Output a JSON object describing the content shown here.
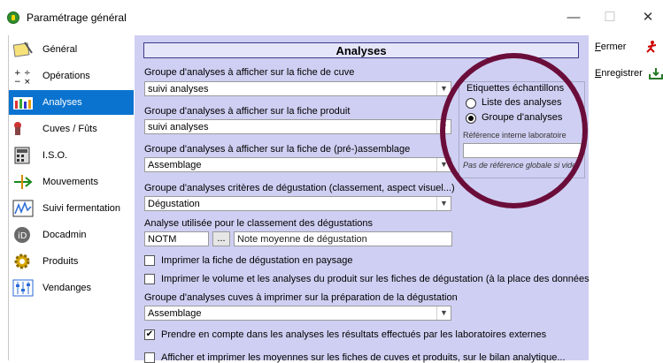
{
  "window": {
    "title": "Paramétrage général",
    "minimize_glyph": "—",
    "maximize_glyph": "☐",
    "close_glyph": "✕"
  },
  "sidebar": {
    "items": [
      {
        "label": "Général",
        "icon": "notepad-icon"
      },
      {
        "label": "Opérations",
        "icon": "math-operators-icon"
      },
      {
        "label": "Analyses",
        "icon": "lab-flasks-icon",
        "active": true
      },
      {
        "label": "Cuves / Fûts",
        "icon": "vat-icon"
      },
      {
        "label": "I.S.O.",
        "icon": "calculator-icon"
      },
      {
        "label": "Mouvements",
        "icon": "arrows-icon"
      },
      {
        "label": "Suivi fermentation",
        "icon": "chart-icon"
      },
      {
        "label": "Docadmin",
        "icon": "docadmin-logo-icon"
      },
      {
        "label": "Produits",
        "icon": "gear-icon"
      },
      {
        "label": "Vendanges",
        "icon": "sliders-icon"
      }
    ]
  },
  "main": {
    "title": "Analyses",
    "fields": {
      "cuve_label": "Groupe d'analyses à afficher sur la fiche de cuve",
      "cuve_value": "suivi analyses",
      "produit_label": "Groupe d'analyses à afficher sur la fiche produit",
      "produit_value": "suivi analyses",
      "assemblage_label": "Groupe d'analyses à afficher sur la fiche de (pré-)assemblage",
      "assemblage_value": "Assemblage",
      "degustation_label": "Groupe d'analyses critères de dégustation (classement, aspect visuel...)",
      "degustation_value": "Dégustation",
      "classement_label": "Analyse utilisée pour le classement des dégustations",
      "classement_code": "NOTM",
      "classement_button": "...",
      "classement_desc": "Note moyenne de dégustation",
      "print_cuves_label": "Groupe d'analyses cuves à imprimer sur la préparation de la dégustation",
      "print_cuves_value": "Assemblage"
    },
    "checkboxes": [
      {
        "label": "Imprimer la fiche de dégustation en paysage",
        "checked": false
      },
      {
        "label": "Imprimer le volume et les analyses du produit sur les fiches de dégustation (à la place des données cuve)",
        "checked": false
      },
      {
        "label": "Prendre en compte dans les analyses les résultats effectués par les laboratoires externes",
        "checked": true
      },
      {
        "label": "Afficher et imprimer les moyennes sur les fiches de cuves et produits, sur le bilan analytique...",
        "checked": false
      }
    ],
    "etiquettes": {
      "title": "Etiquettes échantillons",
      "option1": "Liste des analyses",
      "option2": "Groupe d'analyses",
      "selected": "option2",
      "ref_label": "Référence interne laboratoire",
      "ref_value": "",
      "ref_hint": "Pas de référence globale si vide"
    }
  },
  "right": {
    "close_label_u": "F",
    "close_label_rest": "ermer",
    "save_label_u": "E",
    "save_label_rest": "nregistrer"
  },
  "annotation": {
    "color": "#6b0d3a"
  }
}
